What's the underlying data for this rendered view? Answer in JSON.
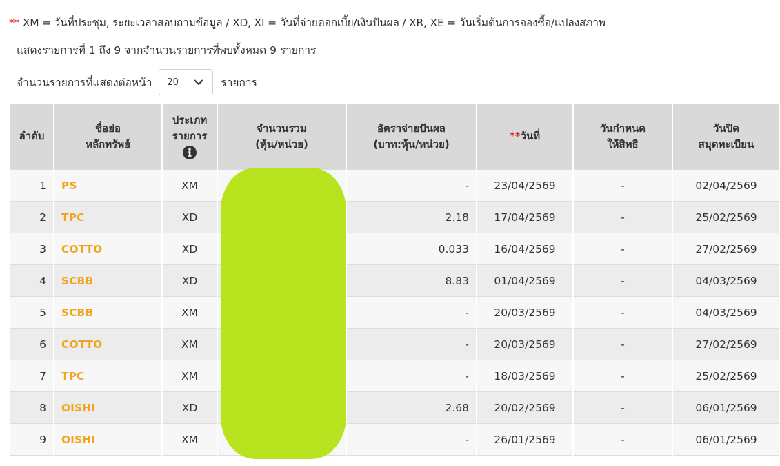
{
  "legend": {
    "stars": "**",
    "text": " XM = วันที่ประชุม, ระยะเวลาสอบถามข้อมูล / XD, XI = วันที่จ่ายดอกเบี้ย/เงินปันผล / XR, XE = วันเริ่มต้นการจองซื้อ/แปลงสภาพ"
  },
  "summary": "แสดงรายการที่ 1 ถึง 9 จากจำนวนรายการที่พบทั้งหมด 9 รายการ",
  "per_page": {
    "label": "จำนวนรายการที่แสดงต่อหน้า",
    "value": "20",
    "suffix": "รายการ",
    "icon": "chevron-down-icon"
  },
  "table": {
    "headers": {
      "no": "ลำดับ",
      "symbol_1": "ชื่อย่อ",
      "symbol_2": "หลักทรัพย์",
      "type_1": "ประเภท",
      "type_2": "รายการ",
      "type_icon": "info-icon",
      "volume_1": "จำนวนรวม",
      "volume_2": "(หุ้น/หน่วย)",
      "rate_1": "อัตราจ่ายปันผล",
      "rate_2": "(บาท:หุ้น/หน่วย)",
      "date_stars": "**",
      "date": "วันที่",
      "right_1": "วันกำหนด",
      "right_2": "ให้สิทธิ",
      "close_1": "วันปิด",
      "close_2": "สมุดทะเบียน"
    },
    "rows": [
      {
        "no": "1",
        "symbol": "PS",
        "type": "XM",
        "rate": "-",
        "date": "23/04/2569",
        "right": "-",
        "close": "02/04/2569"
      },
      {
        "no": "2",
        "symbol": "TPC",
        "type": "XD",
        "rate": "2.18",
        "date": "17/04/2569",
        "right": "-",
        "close": "25/02/2569"
      },
      {
        "no": "3",
        "symbol": "COTTO",
        "type": "XD",
        "rate": "0.033",
        "date": "16/04/2569",
        "right": "-",
        "close": "27/02/2569"
      },
      {
        "no": "4",
        "symbol": "SCBB",
        "type": "XD",
        "rate": "8.83",
        "date": "01/04/2569",
        "right": "-",
        "close": "04/03/2569"
      },
      {
        "no": "5",
        "symbol": "SCBB",
        "type": "XM",
        "rate": "-",
        "date": "20/03/2569",
        "right": "-",
        "close": "04/03/2569"
      },
      {
        "no": "6",
        "symbol": "COTTO",
        "type": "XM",
        "rate": "-",
        "date": "20/03/2569",
        "right": "-",
        "close": "27/02/2569"
      },
      {
        "no": "7",
        "symbol": "TPC",
        "type": "XM",
        "rate": "-",
        "date": "18/03/2569",
        "right": "-",
        "close": "25/02/2569"
      },
      {
        "no": "8",
        "symbol": "OISHI",
        "type": "XD",
        "rate": "2.68",
        "date": "20/02/2569",
        "right": "-",
        "close": "06/01/2569"
      },
      {
        "no": "9",
        "symbol": "OISHI",
        "type": "XM",
        "rate": "-",
        "date": "26/01/2569",
        "right": "-",
        "close": "06/01/2569"
      }
    ]
  },
  "colors": {
    "symbol_link": "#f0a522",
    "star": "#e02020",
    "header_bg": "#d9d9d9",
    "row_odd": "#f7f7f7",
    "row_even": "#ececec",
    "redaction": "#b7e41e"
  }
}
